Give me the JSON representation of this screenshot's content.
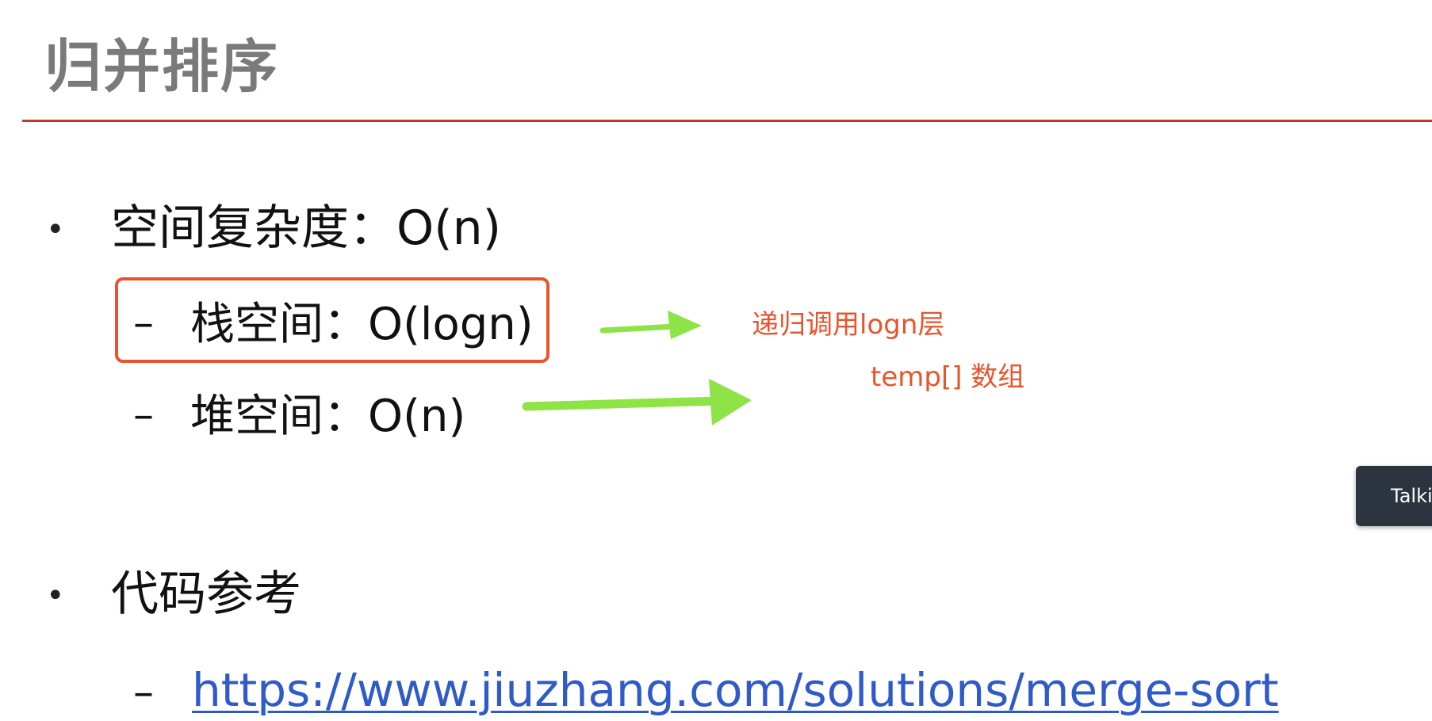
{
  "slide": {
    "title": "归并排序"
  },
  "bullets": {
    "space_complexity": "空间复杂度：O(n)",
    "stack_space": "栈空间：O(logn)",
    "heap_space": "堆空间：O(n)",
    "code_reference": "代码参考",
    "link": "https://www.jiuzhang.com/solutions/merge-sort"
  },
  "annotations": {
    "recursion_note": "递归调用logn层",
    "temp_note": "temp[] 数组"
  },
  "overlay": {
    "chip_text": "Talki"
  },
  "colors": {
    "title": "#7a7a7a",
    "rule": "#c0392b",
    "highlight": "#e8542b",
    "arrow": "#8ee346",
    "link": "#2f5bc8",
    "chip_bg": "#2c3440"
  },
  "icons": {
    "bullet": "bullet-dot-icon",
    "dash": "dash-icon",
    "arrow": "arrow-right-icon"
  }
}
